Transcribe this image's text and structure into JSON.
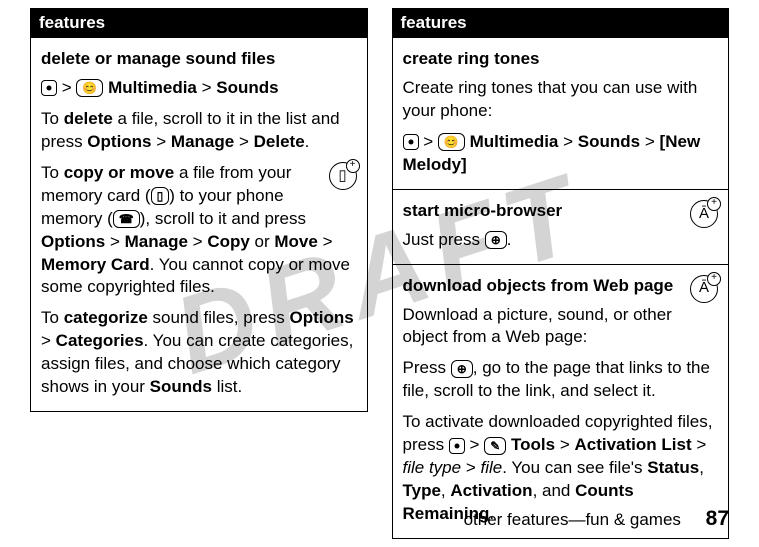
{
  "watermark": "DRAFT",
  "left": {
    "header": "features",
    "section1": {
      "title": "delete or manage sound files",
      "nav_multimedia": "Multimedia",
      "nav_sounds": "Sounds",
      "gt": ">",
      "p1a": "To ",
      "p1b": "delete",
      "p1c": " a file, scroll to it in the list and press ",
      "options": "Options",
      "manage": "Manage",
      "delete": "Delete",
      "period": ".",
      "p2a": "To ",
      "p2b": "copy or move",
      "p2c": " a file from your memory card (",
      "p2d": ") to your phone memory (",
      "p2e": "), scroll to it and press ",
      "copy": "Copy",
      "or": " or ",
      "move": "Move",
      "memcard": "Memory Card",
      "p2f": ". You cannot copy or move some copyrighted files.",
      "p3a": "To ",
      "p3b": "categorize",
      "p3c": " sound files, press ",
      "categories": "Categories",
      "p3d": ". You can create categories, assign files, and choose which category shows in your ",
      "soundslist": "Sounds",
      "p3e": " list."
    }
  },
  "right": {
    "header": "features",
    "section1": {
      "title": "create ring tones",
      "p1": "Create ring tones that you can use with your phone:",
      "multimedia": "Multimedia",
      "sounds": "Sounds",
      "newmelody": "[New Melody]",
      "gt": ">"
    },
    "section2": {
      "title": "start micro-browser",
      "p1a": "Just press ",
      "period": "."
    },
    "section3": {
      "title": "download objects from Web page",
      "p1": "Download a picture, sound, or other object from a Web page:",
      "p2a": "Press ",
      "p2b": ", go to the page that links to the file, scroll to the link, and select it.",
      "p3a": "To activate downloaded copyrighted files, press ",
      "gt": ">",
      "tools": "Tools",
      "activation": "Activation List",
      "filetype": "file type",
      "file": "file",
      "p3b": ". You can see file's ",
      "status": "Status",
      "comma": ", ",
      "type": "Type",
      "activationword": "Activation",
      "and": ", and ",
      "counts": "Counts Remaining",
      "period": "."
    }
  },
  "footer": {
    "text": "other features—fun & games",
    "page": "87"
  }
}
